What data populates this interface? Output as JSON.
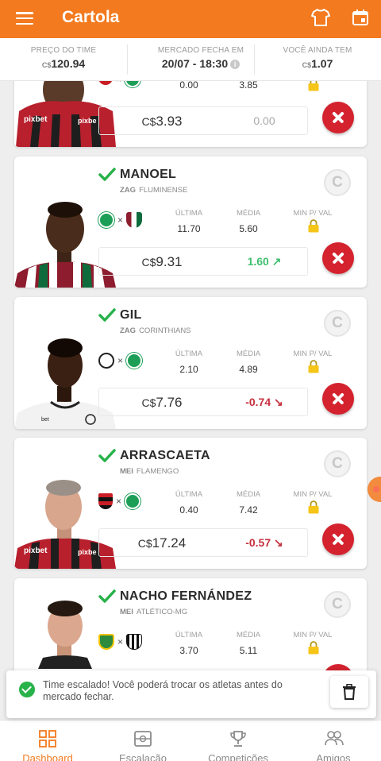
{
  "app": {
    "title": "Cartola"
  },
  "header_icons": [
    "shirt-icon",
    "calendar-icon",
    "menu-icon"
  ],
  "stats": {
    "team_price": {
      "label": "PREÇO DO TIME",
      "currency": "C$",
      "value": "120.94"
    },
    "market": {
      "label": "MERCADO FECHA EM",
      "value": "20/07 - 18:30"
    },
    "balance": {
      "label": "VOCÊ AINDA TEM",
      "currency": "C$",
      "value": "1.07"
    }
  },
  "column_labels": {
    "last": "ÚLTIMA",
    "avg": "MÉDIA",
    "min": "MIN P/ VAL"
  },
  "players": [
    {
      "name": "",
      "position": "",
      "club": "",
      "last": "0.00",
      "avg": "3.85",
      "price": "3.93",
      "currency": "C$",
      "delta": "0.00",
      "trend": "zero"
    },
    {
      "name": "MANOEL",
      "position": "ZAG",
      "club": "FLUMINENSE",
      "last": "11.70",
      "avg": "5.60",
      "price": "9.31",
      "currency": "C$",
      "delta": "1.60",
      "trend": "up"
    },
    {
      "name": "GIL",
      "position": "ZAG",
      "club": "CORINTHIANS",
      "last": "2.10",
      "avg": "4.89",
      "price": "7.76",
      "currency": "C$",
      "delta": "-0.74",
      "trend": "down"
    },
    {
      "name": "ARRASCAETA",
      "position": "MEI",
      "club": "FLAMENGO",
      "last": "0.40",
      "avg": "7.42",
      "price": "17.24",
      "currency": "C$",
      "delta": "-0.57",
      "trend": "down"
    },
    {
      "name": "NACHO FERNÁNDEZ",
      "position": "MEI",
      "club": "ATLÉTICO-MG",
      "last": "3.70",
      "avg": "5.11"
    }
  ],
  "captain_letter": "C",
  "colors": {
    "accent": "#f37a1f",
    "remove": "#d4222f",
    "up": "#3fbf6f",
    "down": "#c7313f",
    "check": "#27b24a"
  },
  "toast": {
    "text": "Time escalado! Você poderá trocar os atletas antes do mercado fechar."
  },
  "nav": [
    {
      "label": "Dashboard",
      "icon": "dashboard-icon",
      "active": true
    },
    {
      "label": "Escalação",
      "icon": "field-icon",
      "active": false
    },
    {
      "label": "Competições",
      "icon": "trophy-icon",
      "active": false
    },
    {
      "label": "Amigos",
      "icon": "friends-icon",
      "active": false
    }
  ]
}
